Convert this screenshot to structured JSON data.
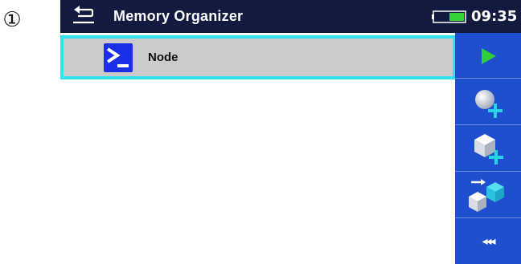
{
  "callout": {
    "number": "①"
  },
  "titlebar": {
    "back_icon": "back-arrow-icon",
    "title": "Memory Organizer",
    "battery_icon": "battery-icon",
    "battery_level": 0.5,
    "time": "09:35"
  },
  "tree": {
    "items": [
      {
        "label": "Node",
        "icon": "node-terminal-icon",
        "selected": true
      }
    ]
  },
  "sidebar": {
    "buttons": [
      {
        "icon": "play-icon"
      },
      {
        "icon": "add-sphere-icon"
      },
      {
        "icon": "add-cube-icon"
      },
      {
        "icon": "move-structure-icon"
      }
    ],
    "more_label": "◂◂◂"
  },
  "colors": {
    "titlebar": "#131a3f",
    "sidebar": "#1d4fcf",
    "selection_border": "#33e0ee",
    "row_background": "#cbcbcb",
    "play_green": "#2fcf3a",
    "plus_cyan": "#2ad3e3"
  }
}
